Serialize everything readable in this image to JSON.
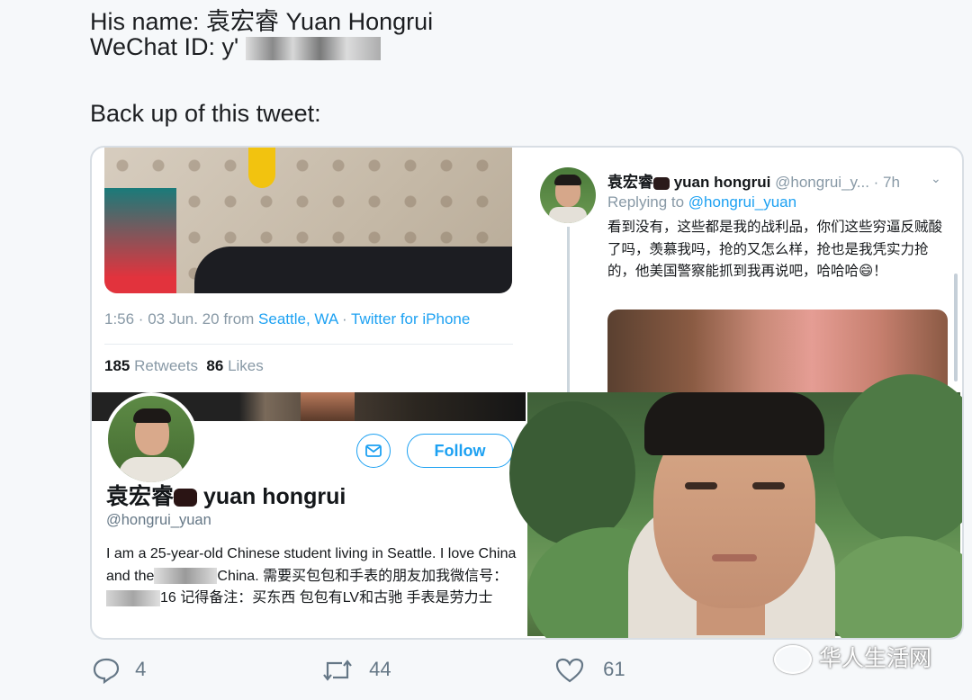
{
  "header": {
    "name_line": "His name: 袁宏睿 Yuan Hongrui",
    "wechat_label": "WeChat ID: y'",
    "backup_line": "Back up of this tweet:"
  },
  "tweet_left": {
    "time": "1:56 · 03 Jun. 20 from ",
    "location": "Seattle, WA",
    "separator": " · ",
    "client": "Twitter for iPhone",
    "retweets_count": "185",
    "retweets_label": " Retweets",
    "likes_count": "86",
    "likes_label": " Likes"
  },
  "tweet_right": {
    "name": "袁宏睿",
    "name_latin": " yuan hongrui",
    "handle_time": " @hongrui_y... · 7h",
    "replying_label": "Replying to ",
    "replying_handle": "@hongrui_yuan",
    "text": "看到没有，这些都是我的战利品，你们这些穷逼反贼酸了吗，羡慕我吗，抢的又怎么样，抢也是我凭实力抢的，他美国警察能抓到我再说吧，哈哈哈😄！"
  },
  "profile": {
    "follow_label": "Follow",
    "name": "袁宏睿",
    "name_latin": " yuan hongrui",
    "handle": "@hongrui_yuan",
    "bio_part1": "I am a 25-year-old Chinese student living in Seattle. I love China and the",
    "bio_part2": "China. 需要买包包和手表的朋友加我微信号：",
    "bio_part3": "16 记得备注：买东西 包包有LV和古驰 手表是劳力士"
  },
  "actions": {
    "reply_count": "4",
    "retweet_count": "44",
    "like_count": "61"
  },
  "watermark": "华人生活网",
  "colors": {
    "link": "#1da1f2",
    "muted": "#8899a6",
    "text": "#14171a"
  }
}
